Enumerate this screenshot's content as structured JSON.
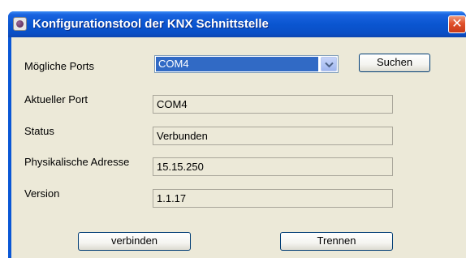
{
  "window": {
    "title": "Konfigurationstool der KNX Schnittstelle",
    "close_glyph": "✕"
  },
  "form": {
    "ports_label": "Mögliche Ports",
    "ports_selected": "COM4",
    "search_button": "Suchen",
    "current_port_label": "Aktueller Port",
    "current_port_value": "COM4",
    "status_label": "Status",
    "status_value": "Verbunden",
    "physical_address_label": "Physikalische Adresse",
    "physical_address_value": "15.15.250",
    "version_label": "Version",
    "version_value": "1.1.17"
  },
  "actions": {
    "connect_button": "verbinden",
    "disconnect_button": "Trennen"
  },
  "icons": {
    "app_icon": "app-icon",
    "close": "close-icon",
    "dropdown": "chevron-down-icon"
  },
  "colors": {
    "titlebar": "#0a55d0",
    "client_bg": "#ece9d8",
    "selection": "#316ac5",
    "close": "#e0502a"
  }
}
